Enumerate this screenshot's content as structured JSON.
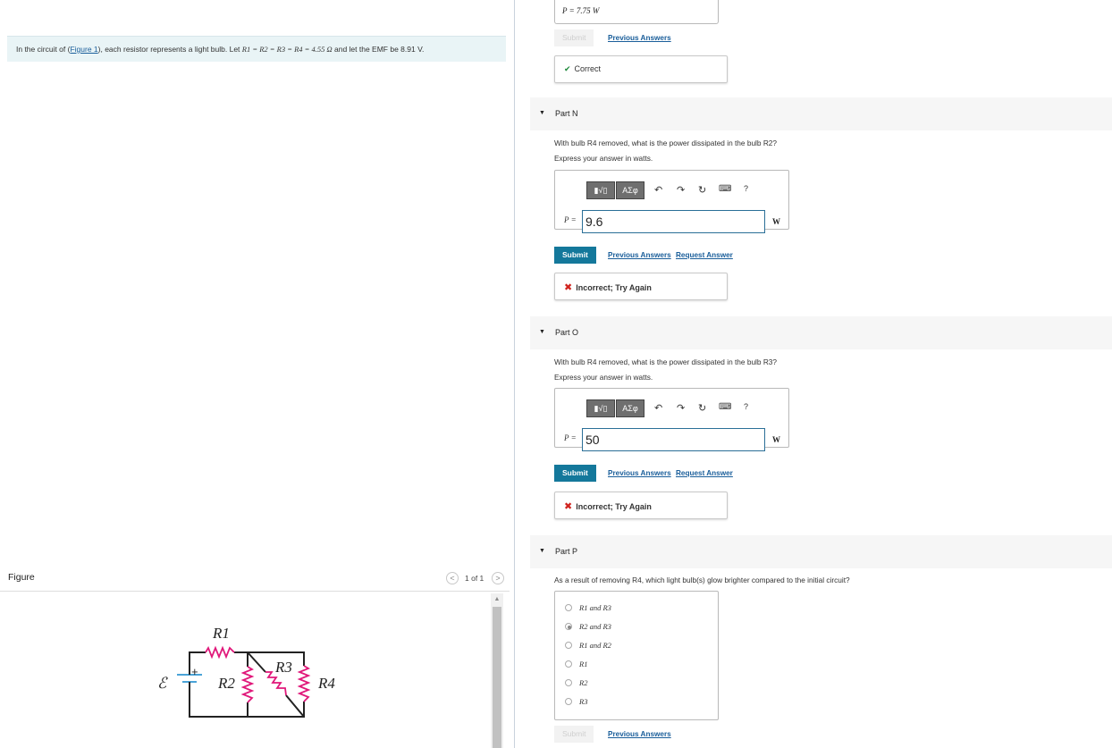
{
  "problem": {
    "intro_prefix": "In the circuit of (",
    "figure_link": "Figure 1",
    "intro_suffix": "), each resistor represents a light bulb. Let ",
    "equality": "R1 = R2 = R3 = R4 = 4.55 Ω",
    "emf_text": " and let the EMF be 8.91 V."
  },
  "figure": {
    "title": "Figure",
    "counter": "1 of 1",
    "prev": "<",
    "next": ">",
    "labels": {
      "r1": "R1",
      "r2": "R2",
      "r3": "R3",
      "r4": "R4",
      "emf": "ℰ",
      "plus": "+"
    }
  },
  "top_answer": {
    "text": "P =  7.75  W",
    "submit": "Submit",
    "prev_answers": "Previous Answers",
    "feedback": "Correct",
    "feedback_icon": "✔"
  },
  "parts": [
    {
      "label": "Part N",
      "question": "With bulb R4 removed, what is the power dissipated in the bulb R2?",
      "instruction": "Express your answer in watts.",
      "var": "P =",
      "value": "9.6",
      "unit": "W",
      "submit": "Submit",
      "prev_answers": "Previous Answers",
      "request_answer": "Request Answer",
      "feedback": "Incorrect; Try Again",
      "feedback_icon": "✖"
    },
    {
      "label": "Part O",
      "question": "With bulb R4 removed, what is the power dissipated in the bulb R3?",
      "instruction": "Express your answer in watts.",
      "var": "P =",
      "value": "50",
      "unit": "W",
      "submit": "Submit",
      "prev_answers": "Previous Answers",
      "request_answer": "Request Answer",
      "feedback": "Incorrect; Try Again",
      "feedback_icon": "✖"
    },
    {
      "label": "Part P",
      "question": "As a result of removing R4, which light bulb(s) glow brighter compared to the initial circuit?",
      "options": [
        "R1 and R3",
        "R2 and R3",
        "R1 and R2",
        "R1",
        "R2",
        "R3"
      ],
      "selected_index": 1,
      "submit": "Submit",
      "prev_answers": "Previous Answers"
    }
  ],
  "toolbar": {
    "template_btn": "▮√▯",
    "symbol_btn": "ΑΣφ",
    "undo_icon": "↶",
    "redo_icon": "↷",
    "reset_icon": "↻",
    "keyboard_icon": "⌨",
    "help_icon": "?"
  },
  "colors": {
    "submit_bg": "#14789b",
    "link": "#1a5e9a",
    "correct": "#1f8a3c",
    "incorrect": "#d0231e",
    "resistor": "#e0187a",
    "problem_bg": "#e9f4f6"
  }
}
